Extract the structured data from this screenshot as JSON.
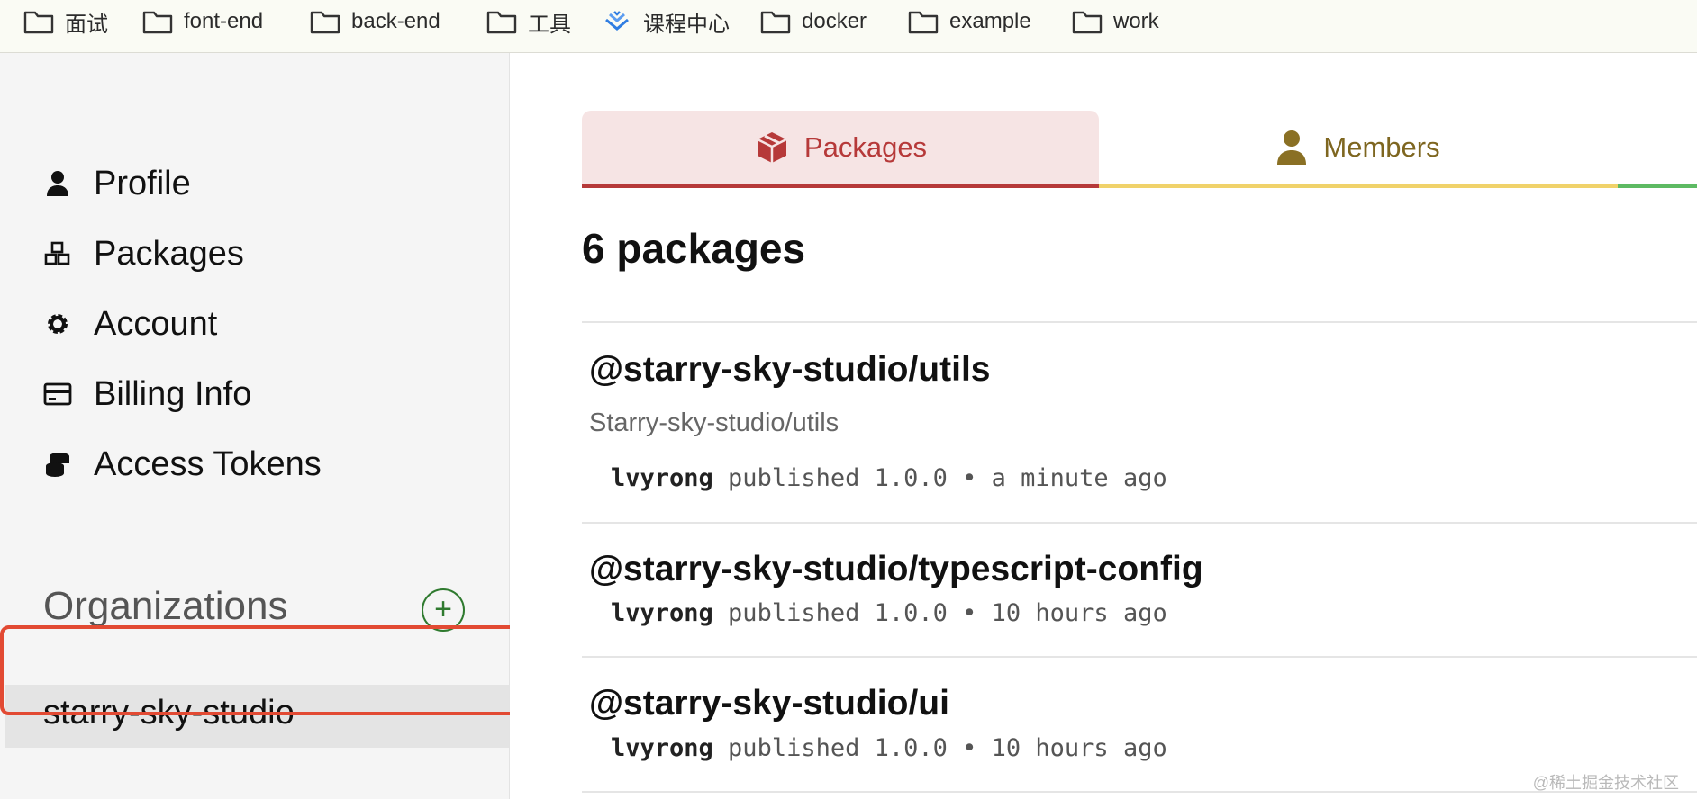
{
  "bookmarks": [
    {
      "label": "面试",
      "icon": "folder-icon"
    },
    {
      "label": "font-end",
      "icon": "folder-icon"
    },
    {
      "label": "back-end",
      "icon": "folder-icon"
    },
    {
      "label": "工具",
      "icon": "folder-icon"
    },
    {
      "label": "课程中心",
      "icon": "course-logo-icon"
    },
    {
      "label": "docker",
      "icon": "folder-icon"
    },
    {
      "label": "example",
      "icon": "folder-icon"
    },
    {
      "label": "work",
      "icon": "folder-icon"
    }
  ],
  "sidebar": {
    "items": [
      {
        "label": "Profile",
        "icon": "user-icon"
      },
      {
        "label": "Packages",
        "icon": "cubes-icon"
      },
      {
        "label": "Account",
        "icon": "gear-icon"
      },
      {
        "label": "Billing Info",
        "icon": "credit-card-icon"
      },
      {
        "label": "Access Tokens",
        "icon": "coins-icon"
      }
    ],
    "organizations_heading": "Organizations",
    "add_label": "+",
    "org": "starry-sky-studio"
  },
  "main": {
    "tabs": [
      {
        "label": "Packages",
        "icon": "box-icon",
        "color": "#b63939"
      },
      {
        "label": "Members",
        "icon": "user-icon",
        "color": "#7e6620"
      }
    ],
    "count_label": "6 packages",
    "packages": [
      {
        "name": "@starry-sky-studio/utils",
        "description": "Starry-sky-studio/utils",
        "author": "lvyrong",
        "meta": " published 1.0.0 • a minute ago"
      },
      {
        "name": "@starry-sky-studio/typescript-config",
        "author": "lvyrong",
        "meta": " published 1.0.0 • 10 hours ago"
      },
      {
        "name": "@starry-sky-studio/ui",
        "author": "lvyrong",
        "meta": " published 1.0.0 • 10 hours ago"
      }
    ]
  },
  "watermark": "@稀土掘金技术社区"
}
